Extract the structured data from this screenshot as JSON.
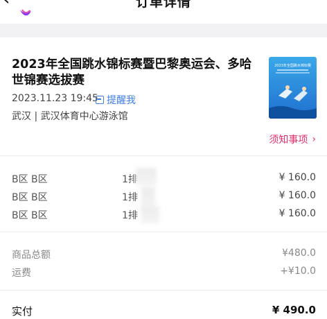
{
  "header": {
    "title": "订单详情",
    "back_icon": "chevron-left-icon"
  },
  "event": {
    "title": "2023年全国跳水锦标赛暨巴黎奥运会、多哈世锦赛选拔赛",
    "datetime": "2023.11.23 19:45",
    "remind_label": "提醒我",
    "venue": "武汉 | 武汉体育中心游泳馆",
    "notice_label": "须知事项",
    "poster_title": "2023年全国跳水锦标赛"
  },
  "tickets": [
    {
      "area": "B区 B区",
      "row": "1排",
      "price": "¥ 160.0"
    },
    {
      "area": "B区 B区",
      "row": "1排",
      "price": "¥ 160.0"
    },
    {
      "area": "B区 B区",
      "row": "1排",
      "price": "¥ 160.0"
    }
  ],
  "summary": {
    "subtotal_label": "商品总额",
    "subtotal_value": "¥480.0",
    "shipping_label": "运费",
    "shipping_value": "+¥10.0",
    "paid_label": "实付",
    "paid_value": "¥ 490.0"
  },
  "colors": {
    "accent_blue": "#3f7de8",
    "notice_pink": "#e0306a",
    "background": "#f2f2f4"
  }
}
